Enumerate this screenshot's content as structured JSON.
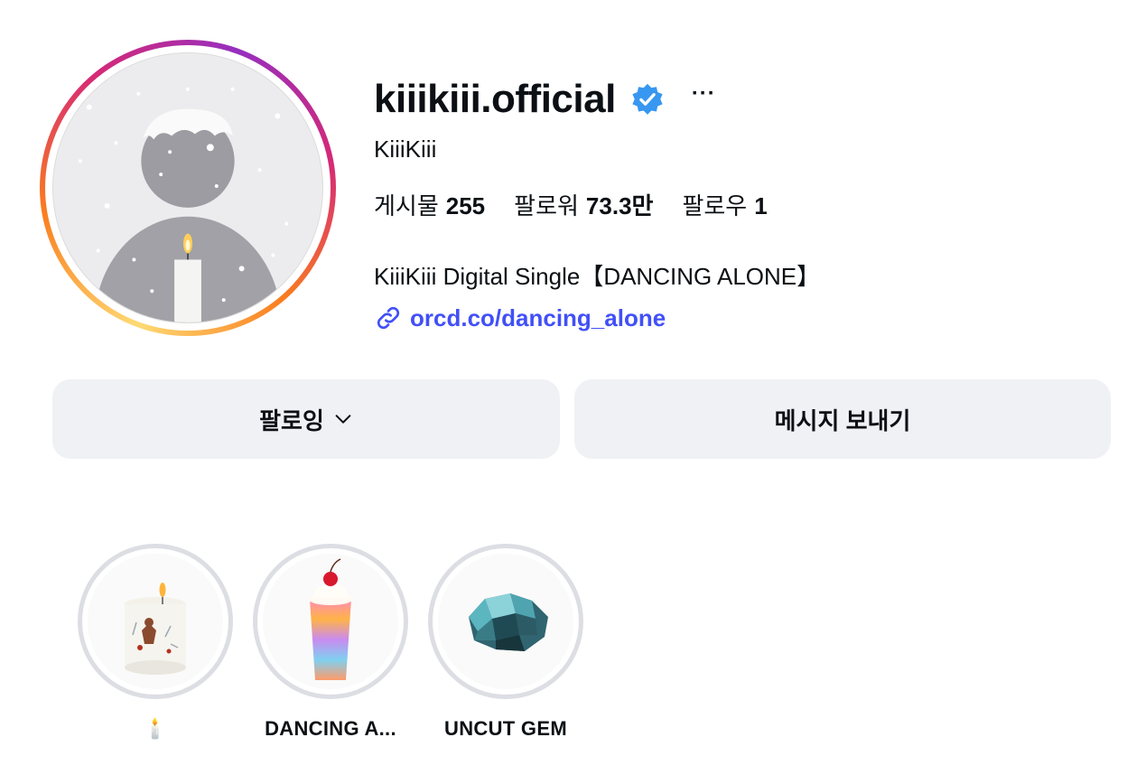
{
  "profile": {
    "username": "kiiikiii.official",
    "full_name": "KiiiKiii",
    "more_label": "···",
    "verified_icon": "verified-badge-icon",
    "stats": {
      "posts_label": "게시물",
      "posts_value": "255",
      "followers_label": "팔로워",
      "followers_value": "73.3만",
      "following_label": "팔로우",
      "following_value": "1"
    },
    "bio": "KiiiKiii Digital Single【DANCING ALONE】",
    "link": "orcd.co/dancing_alone"
  },
  "actions": {
    "follow_label": "팔로잉",
    "message_label": "메시지 보내기"
  },
  "highlights": [
    {
      "label": "🕯️",
      "icon": "candle-icon"
    },
    {
      "label": "DANCING A...",
      "icon": "milkshake-icon"
    },
    {
      "label": "UNCUT GEM",
      "icon": "gem-icon"
    }
  ],
  "colors": {
    "link": "#4150f7",
    "verified": "#3897f0",
    "button_bg": "#eff1f5",
    "story_ring": [
      "#feda75",
      "#fa7e1e",
      "#d62976",
      "#962fbf"
    ]
  }
}
